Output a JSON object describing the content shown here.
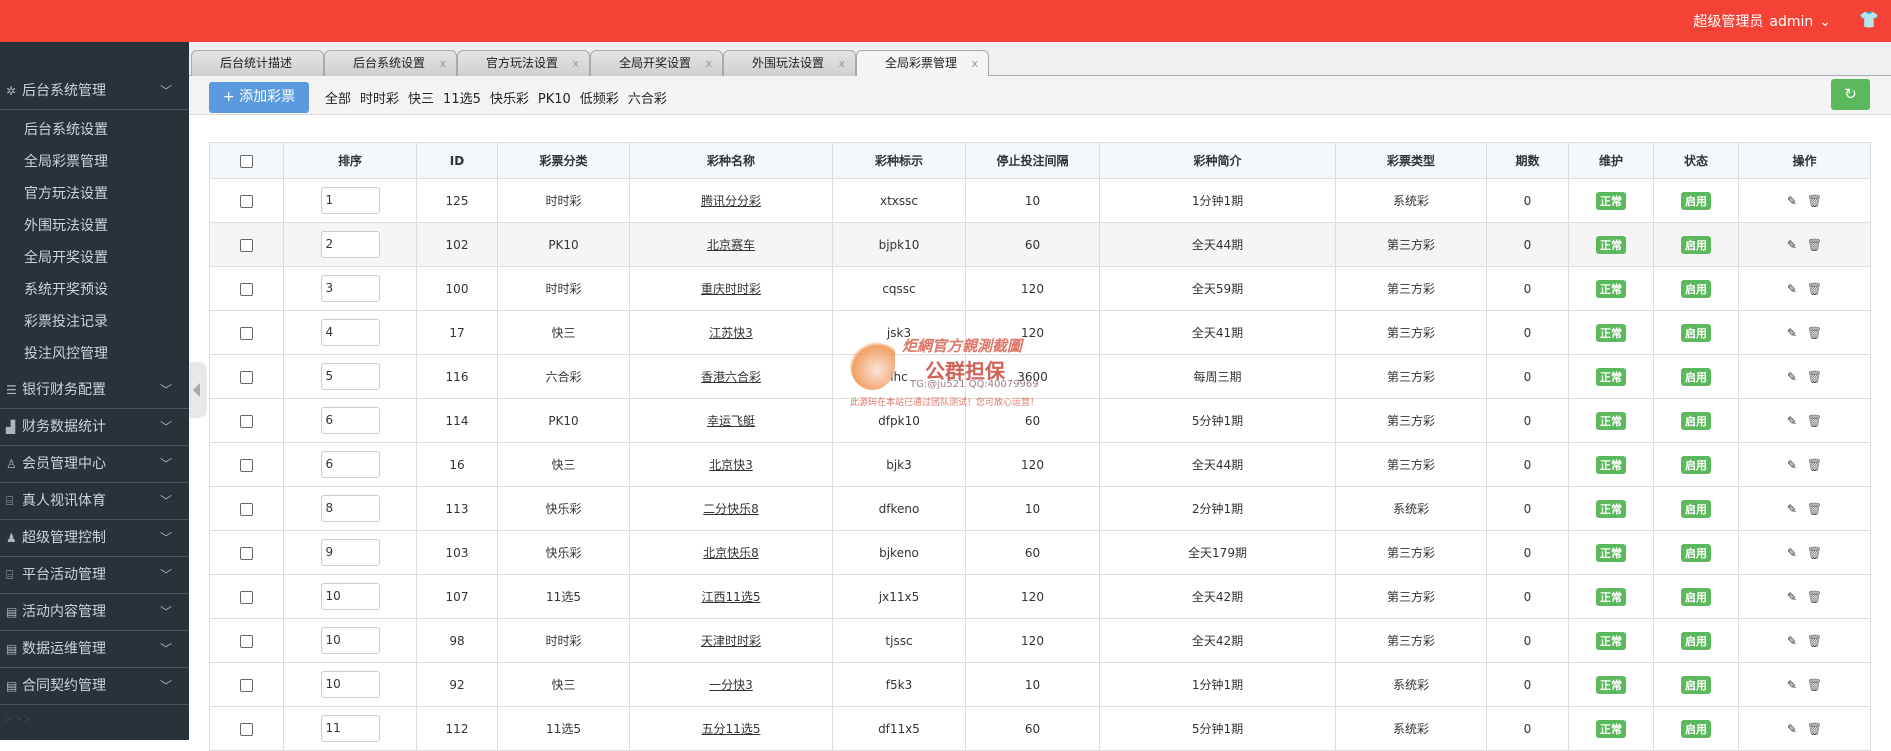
{
  "header": {
    "role": "超级管理员",
    "user": "admin",
    "user_chevron": "⌄",
    "shirt_icon": "shirt-icon"
  },
  "sidebar": {
    "groups": [
      {
        "label": "后台系统管理",
        "icon": "gear-icon",
        "glyph": "✲"
      },
      {
        "label": "银行财务配置",
        "icon": "list-icon",
        "glyph": "☰"
      },
      {
        "label": "财务数据统计",
        "icon": "chart-icon",
        "glyph": "▟"
      },
      {
        "label": "会员管理中心",
        "icon": "user-icon",
        "glyph": "♙"
      },
      {
        "label": "真人视讯体育",
        "icon": "gift-icon",
        "glyph": "⌸"
      },
      {
        "label": "超级管理控制",
        "icon": "user-solid-icon",
        "glyph": "♟"
      },
      {
        "label": "平台活动管理",
        "icon": "gift-icon",
        "glyph": "⌸"
      },
      {
        "label": "活动内容管理",
        "icon": "book-icon",
        "glyph": "▤"
      },
      {
        "label": "数据运维管理",
        "icon": "book-icon",
        "glyph": "▤"
      },
      {
        "label": "合同契约管理",
        "icon": "book-icon",
        "glyph": "▤"
      }
    ],
    "sub_items": [
      "后台系统设置",
      "全局彩票管理",
      "官方玩法设置",
      "外围玩法设置",
      "全局开奖设置",
      "系统开奖预设",
      "彩票投注记录",
      "投注风控管理"
    ],
    "more": ">>>"
  },
  "tabs": [
    {
      "label": "后台统计描述",
      "closable": false
    },
    {
      "label": "后台系统设置",
      "closable": true
    },
    {
      "label": "官方玩法设置",
      "closable": true
    },
    {
      "label": "全局开奖设置",
      "closable": true
    },
    {
      "label": "外围玩法设置",
      "closable": true
    },
    {
      "label": "全局彩票管理",
      "closable": true,
      "active": true
    }
  ],
  "tab_close": "x",
  "toolbar": {
    "add_label": "+ 添加彩票",
    "filters": [
      "全部",
      "时时彩",
      "快三",
      "11选5",
      "快乐彩",
      "PK10",
      "低频彩",
      "六合彩"
    ],
    "refresh_glyph": "↻"
  },
  "table": {
    "columns": [
      "",
      "排序",
      "ID",
      "彩票分类",
      "彩种名称",
      "彩种标示",
      "停止投注间隔",
      "彩种简介",
      "彩票类型",
      "期数",
      "维护",
      "状态",
      "操作"
    ],
    "rows": [
      {
        "sort": "1",
        "id": "125",
        "category": "时时彩",
        "name": "腾讯分分彩",
        "code": "xtxssc",
        "interval": "10",
        "intro": "1分钟1期",
        "type": "系统彩",
        "periods": "0",
        "maintain": "正常",
        "status": "启用"
      },
      {
        "sort": "2",
        "id": "102",
        "category": "PK10",
        "name": "北京赛车",
        "code": "bjpk10",
        "interval": "60",
        "intro": "全天44期",
        "type": "第三方彩",
        "periods": "0",
        "maintain": "正常",
        "status": "启用"
      },
      {
        "sort": "3",
        "id": "100",
        "category": "时时彩",
        "name": "重庆时时彩",
        "code": "cqssc",
        "interval": "120",
        "intro": "全天59期",
        "type": "第三方彩",
        "periods": "0",
        "maintain": "正常",
        "status": "启用"
      },
      {
        "sort": "4",
        "id": "17",
        "category": "快三",
        "name": "江苏快3",
        "code": "jsk3",
        "interval": "120",
        "intro": "全天41期",
        "type": "第三方彩",
        "periods": "0",
        "maintain": "正常",
        "status": "启用"
      },
      {
        "sort": "5",
        "id": "116",
        "category": "六合彩",
        "name": "香港六合彩",
        "code": "lhc",
        "interval": "3600",
        "intro": "每周三期",
        "type": "第三方彩",
        "periods": "0",
        "maintain": "正常",
        "status": "启用"
      },
      {
        "sort": "6",
        "id": "114",
        "category": "PK10",
        "name": "幸运飞艇",
        "code": "dfpk10",
        "interval": "60",
        "intro": "5分钟1期",
        "type": "第三方彩",
        "periods": "0",
        "maintain": "正常",
        "status": "启用"
      },
      {
        "sort": "6",
        "id": "16",
        "category": "快三",
        "name": "北京快3",
        "code": "bjk3",
        "interval": "120",
        "intro": "全天44期",
        "type": "第三方彩",
        "periods": "0",
        "maintain": "正常",
        "status": "启用"
      },
      {
        "sort": "8",
        "id": "113",
        "category": "快乐彩",
        "name": "二分快乐8",
        "code": "dfkeno",
        "interval": "10",
        "intro": "2分钟1期",
        "type": "系统彩",
        "periods": "0",
        "maintain": "正常",
        "status": "启用"
      },
      {
        "sort": "9",
        "id": "103",
        "category": "快乐彩",
        "name": "北京快乐8",
        "code": "bjkeno",
        "interval": "60",
        "intro": "全天179期",
        "type": "第三方彩",
        "periods": "0",
        "maintain": "正常",
        "status": "启用"
      },
      {
        "sort": "10",
        "id": "107",
        "category": "11选5",
        "name": "江西11选5",
        "code": "jx11x5",
        "interval": "120",
        "intro": "全天42期",
        "type": "第三方彩",
        "periods": "0",
        "maintain": "正常",
        "status": "启用"
      },
      {
        "sort": "10",
        "id": "98",
        "category": "时时彩",
        "name": "天津时时彩",
        "code": "tjssc",
        "interval": "120",
        "intro": "全天42期",
        "type": "第三方彩",
        "periods": "0",
        "maintain": "正常",
        "status": "启用"
      },
      {
        "sort": "10",
        "id": "92",
        "category": "快三",
        "name": "一分快3",
        "code": "f5k3",
        "interval": "10",
        "intro": "1分钟1期",
        "type": "系统彩",
        "periods": "0",
        "maintain": "正常",
        "status": "启用"
      },
      {
        "sort": "11",
        "id": "112",
        "category": "11选5",
        "name": "五分11选5",
        "code": "df11x5",
        "interval": "60",
        "intro": "5分钟1期",
        "type": "系统彩",
        "periods": "0",
        "maintain": "正常",
        "status": "启用"
      }
    ],
    "edit_glyph": "✎",
    "delete_glyph": "🗑"
  },
  "watermark": {
    "line1": "炬網官方親測截圖",
    "line2": "公群担保",
    "line3": "TG:@ju521  QQ:40079969",
    "line4": "此源码在本站已通过团队测试！您可放心运营！"
  },
  "colors": {
    "header": "#f44336",
    "sidebar": "#27323a",
    "primary": "#5b9bdd",
    "success": "#5cb85c"
  }
}
